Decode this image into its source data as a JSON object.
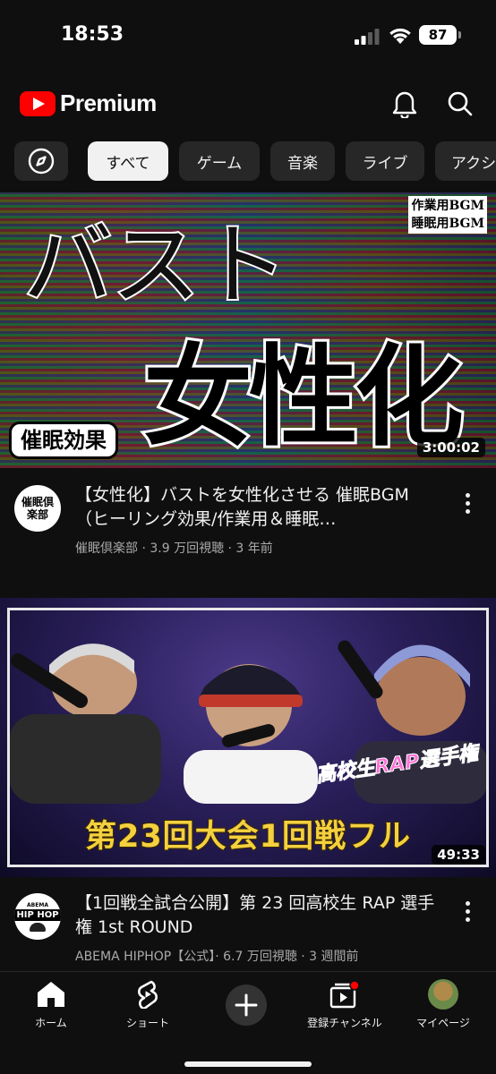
{
  "status_bar": {
    "time": "18:53",
    "battery": "87"
  },
  "header": {
    "brand": "Premium",
    "notifications_icon": "bell-icon",
    "search_icon": "search-icon"
  },
  "chips": [
    {
      "label": "すべて",
      "active": true
    },
    {
      "label": "ゲーム",
      "active": false
    },
    {
      "label": "音楽",
      "active": false
    },
    {
      "label": "ライブ",
      "active": false
    },
    {
      "label": "アクシ",
      "active": false
    }
  ],
  "videos": [
    {
      "thumbnail": {
        "headline": "バスト",
        "main_text": "女性化",
        "tag_line1": "作業用BGM",
        "tag_line2": "睡眠用BGM",
        "badge": "催眠効果"
      },
      "duration": "3:00:02",
      "channel_avatar_text": "催眠倶楽部",
      "title": "【女性化】バストを女性化させる 催眠BGM（ヒーリング効果/作業用＆睡眠…",
      "subtitle": "催眠倶楽部 · 3.9 万回視聴 · 3 年前"
    },
    {
      "thumbnail": {
        "banner": "第23回大会1回戦フル",
        "event_logo": "高校生RAP選手権"
      },
      "duration": "49:33",
      "channel_avatar_text": "HIP HOP",
      "channel_avatar_top": "ABEMA",
      "title": "【1回戦全試合公開】第 23 回高校生 RAP 選手権 1st ROUND",
      "subtitle": "ABEMA HIPHOP【公式】· 6.7 万回視聴 · 3 週間前"
    }
  ],
  "bottom_nav": {
    "home": "ホーム",
    "shorts": "ショート",
    "subscriptions": "登録チャンネル",
    "you": "マイページ"
  }
}
